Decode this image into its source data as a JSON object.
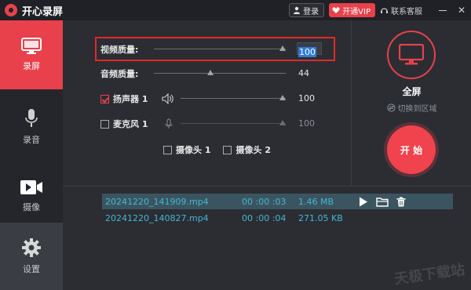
{
  "app": {
    "title": "开心录屏"
  },
  "titlebar": {
    "login_label": "登录",
    "vip_label": "开通VIP",
    "service_label": "联系客服",
    "close_glyph": "✕"
  },
  "sidebar": {
    "items": [
      {
        "label": "录屏",
        "icon": "monitor-icon",
        "active": true
      },
      {
        "label": "录音",
        "icon": "microphone-icon",
        "active": false
      },
      {
        "label": "摄像",
        "icon": "camera-icon",
        "active": false
      },
      {
        "label": "设置",
        "icon": "gear-icon",
        "active": false
      }
    ]
  },
  "settings": {
    "video_quality": {
      "label": "视频质量:",
      "value": "100"
    },
    "audio_quality": {
      "label": "音频质量:",
      "value": "44"
    },
    "speaker": {
      "label": "扬声器 1",
      "checked": true,
      "value": "100"
    },
    "microphone": {
      "label": "麦克风 1",
      "checked": false,
      "value": "100"
    },
    "camera1": {
      "label": "摄像头 1",
      "checked": false
    },
    "camera2": {
      "label": "摄像头 2",
      "checked": false
    }
  },
  "capture": {
    "mode_label": "全屏",
    "switch_label": "切换到区域",
    "start_label": "开 始"
  },
  "files": [
    {
      "name": "20241220_141909.mp4",
      "duration": "00 :00 :03",
      "size": "1.46 MB",
      "selected": true
    },
    {
      "name": "20241220_140827.mp4",
      "duration": "00 :00 :04",
      "size": "271.05 KB",
      "selected": false
    }
  ],
  "watermark": "天极下载站",
  "colors": {
    "accent": "#e8414b",
    "file_text": "#44b6d6",
    "selected_row": "#3b5560"
  }
}
